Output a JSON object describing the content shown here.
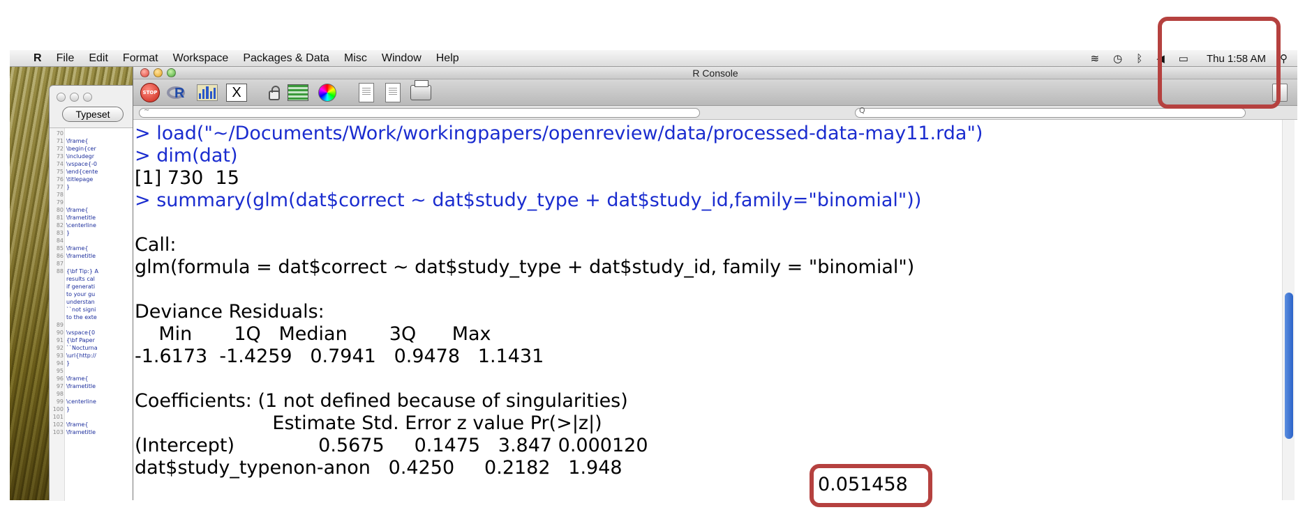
{
  "menubar": {
    "apple_icon": "apple-icon",
    "app_name": "R",
    "items": [
      "File",
      "Edit",
      "Format",
      "Workspace",
      "Packages & Data",
      "Misc",
      "Window",
      "Help"
    ],
    "status_icons": [
      "wifi-icon",
      "time-machine-icon",
      "bluetooth-icon",
      "volume-icon",
      "battery-icon"
    ],
    "clock": "Thu 1:58 AM"
  },
  "editor_window": {
    "typeset_label": "Typeset",
    "lines": [
      {
        "num": "70",
        "code": ""
      },
      {
        "num": "71",
        "code": "\\frame{"
      },
      {
        "num": "72",
        "code": "\\begin{cer"
      },
      {
        "num": "73",
        "code": "\\includegr"
      },
      {
        "num": "74",
        "code": "\\vspace{-0"
      },
      {
        "num": "75",
        "code": "\\end{cente"
      },
      {
        "num": "76",
        "code": "\\titlepage"
      },
      {
        "num": "77",
        "code": "}"
      },
      {
        "num": "78",
        "code": ""
      },
      {
        "num": "79",
        "code": ""
      },
      {
        "num": "80",
        "code": "\\frame{"
      },
      {
        "num": "81",
        "code": "\\frametitle"
      },
      {
        "num": "82",
        "code": "\\centerline"
      },
      {
        "num": "83",
        "code": "}"
      },
      {
        "num": "84",
        "code": ""
      },
      {
        "num": "85",
        "code": "\\frame{"
      },
      {
        "num": "86",
        "code": "\\frametitle"
      },
      {
        "num": "87",
        "code": ""
      },
      {
        "num": "88",
        "code": "{\\bf Tip:} A"
      },
      {
        "num": "",
        "code": "results cal"
      },
      {
        "num": "",
        "code": "if generati"
      },
      {
        "num": "",
        "code": "to your gu"
      },
      {
        "num": "",
        "code": "understan"
      },
      {
        "num": "",
        "code": "``not signi"
      },
      {
        "num": "",
        "code": "to the exte"
      },
      {
        "num": "89",
        "code": ""
      },
      {
        "num": "90",
        "code": "\\vspace{0"
      },
      {
        "num": "91",
        "code": "{\\bf Paper"
      },
      {
        "num": "92",
        "code": "``Nocturna"
      },
      {
        "num": "93",
        "code": "\\url{http://"
      },
      {
        "num": "94",
        "code": "}"
      },
      {
        "num": "95",
        "code": ""
      },
      {
        "num": "96",
        "code": "\\frame{"
      },
      {
        "num": "97",
        "code": "\\frametitle"
      },
      {
        "num": "98",
        "code": ""
      },
      {
        "num": "99",
        "code": "\\centerline"
      },
      {
        "num": "100",
        "code": "}"
      },
      {
        "num": "101",
        "code": ""
      },
      {
        "num": "102",
        "code": "\\frame{"
      },
      {
        "num": "103",
        "code": "\\frametitle"
      }
    ]
  },
  "console": {
    "title": "R Console",
    "toolbar_icons": [
      "stop-icon",
      "r-logo-icon",
      "bar-chart-icon",
      "x11-icon",
      "lock-icon",
      "list-icon",
      "color-wheel-icon",
      "document-copy-icon",
      "new-document-icon",
      "printer-icon"
    ],
    "path_field_value": "~",
    "search_icon": "Q",
    "lines": [
      {
        "text": "> load(\"~/Documents/Work/workingpapers/openreview/data/processed-data-may11.rda\")",
        "kind": "cmd"
      },
      {
        "text": "> dim(dat)",
        "kind": "cmd"
      },
      {
        "text": "[1] 730  15",
        "kind": "out"
      },
      {
        "text": "> summary(glm(dat$correct ~ dat$study_type + dat$study_id,family=\"binomial\"))",
        "kind": "cmd"
      },
      {
        "text": "",
        "kind": "out"
      },
      {
        "text": "Call:",
        "kind": "out"
      },
      {
        "text": "glm(formula = dat$correct ~ dat$study_type + dat$study_id, family = \"binomial\")",
        "kind": "out"
      },
      {
        "text": "",
        "kind": "out"
      },
      {
        "text": "Deviance Residuals:",
        "kind": "out"
      },
      {
        "text": "    Min       1Q   Median       3Q      Max  ",
        "kind": "out"
      },
      {
        "text": "-1.6173  -1.4259   0.7941   0.9478   1.1431  ",
        "kind": "out"
      },
      {
        "text": "",
        "kind": "out"
      },
      {
        "text": "Coefficients: (1 not defined because of singularities)",
        "kind": "out"
      },
      {
        "text": "                       Estimate Std. Error z value Pr(>|z|)",
        "kind": "out"
      },
      {
        "text": "(Intercept)              0.5675     0.1475   3.847 0.000120",
        "kind": "out"
      },
      {
        "text": "dat$study_typenon-anon   0.4250     0.2182   1.948",
        "kind": "out"
      }
    ],
    "highlighted_pvalue": "0.051458"
  }
}
